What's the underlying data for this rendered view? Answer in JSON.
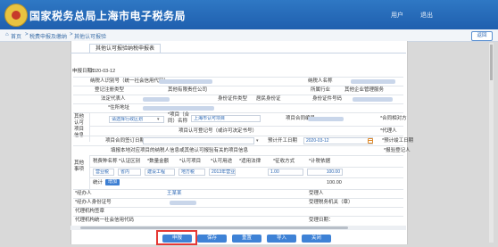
{
  "header": {
    "title": "国家税务总局上海市电子税务局",
    "user_label": "用户",
    "logout_label": "退出"
  },
  "breadcrumb": {
    "home": "首页",
    "level1": "税费申报及缴纳",
    "level2": "其他认可报验"
  },
  "back_button": "返回",
  "form": {
    "tab_label": "其他认可报验纳税申报表",
    "apply_date_label": "申报日期：",
    "apply_date_value": "2020-03-12",
    "taxpayer_id_label": "纳税人识别号（统一社会信用代码）",
    "taxpayer_name_label": "纳税人名称",
    "reg_type_label": "登记注册类型",
    "reg_type_value": "其他有限责任公司",
    "industry_label": "所属行业",
    "industry_value": "其他企业管理服务",
    "legal_rep_label": "法定代表人",
    "id_type_label": "身份证件类型",
    "id_type_value": "居民身份证",
    "id_no_label": "身份证件号码",
    "address_label": "*住所地址",
    "other_group_label": "其他认可项目信息",
    "select_value": "请选择行政区划",
    "project_name_label": "*项目（合同）名称",
    "project_name_value": "上海市认可项目",
    "contract_no_label": "项目合同编号",
    "contract_party_label": "*合同相对方",
    "registration_no_label": "项目认可登记号（或许可决定书号）",
    "agent_label": "*代理人",
    "contract_date_label": "项目合同签订日期",
    "start_date_label": "预计开工日期",
    "start_date_value": "2020-03-12",
    "end_date_label": "*预计竣工日期",
    "public_note_label": "填报本地对应项目的纳税人信息或其他认可报验有关的项目信息",
    "registrant_label": "*报验登记人",
    "item_label": "其他事项",
    "table_cols": [
      "税费种名称",
      "*认证区别",
      "*数量金额",
      "*认可项目",
      "*认可用途",
      "*适用法律",
      "*征收方式",
      "*计税依据"
    ],
    "table_row": [
      "营业税",
      "省内",
      "建设工程",
      "地方税",
      "2013年营业税",
      "1.00",
      "100.00"
    ],
    "add_label": "增加",
    "delete_label": "删除",
    "count_label": "统计",
    "total_value": "100.00",
    "bottom_rows": [
      "*经办人",
      "*经办人身份证号",
      "代理机构签章",
      "代理机构统一社会信用代码"
    ],
    "bottom_value": "王某某",
    "receiver_label": "受理人",
    "receive_org_label": "受理税务机关（章）",
    "receive_date_label": "受理日期："
  },
  "actions": [
    {
      "label": "申报",
      "color": "#3e82d6"
    },
    {
      "label": "保存",
      "color": "#3e82d6"
    },
    {
      "label": "重置",
      "color": "#3e82d6"
    },
    {
      "label": "导入",
      "color": "#3e82d6"
    },
    {
      "label": "关闭",
      "color": "#3e82d6"
    }
  ]
}
